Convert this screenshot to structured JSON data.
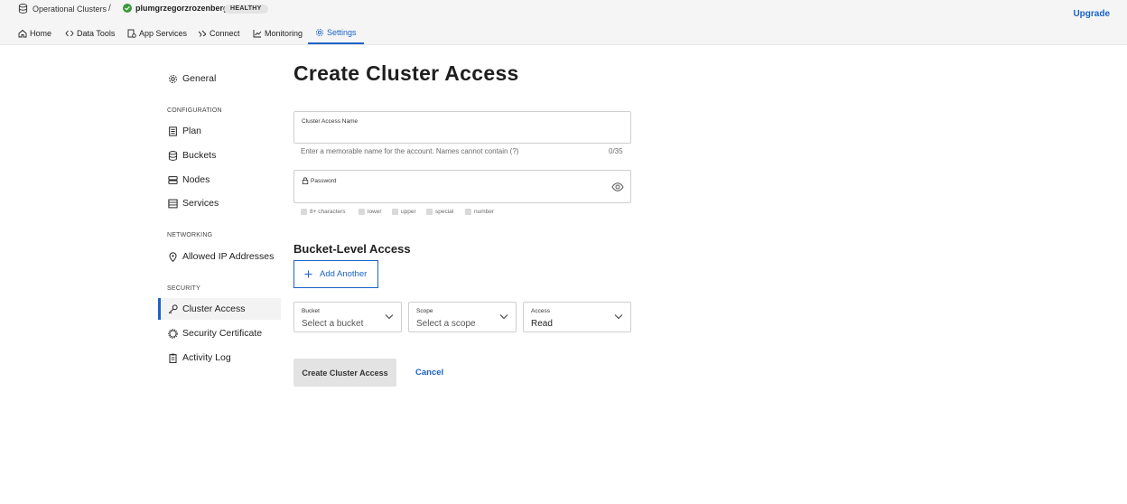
{
  "breadcrumb": {
    "root": "Operational Clusters",
    "separator": "/",
    "cluster": "plumgrzegorzrozenberg",
    "status": "HEALTHY"
  },
  "header": {
    "upgrade": "Upgrade"
  },
  "tabs": [
    {
      "label": "Home",
      "icon": "home-icon"
    },
    {
      "label": "Data Tools",
      "icon": "code-icon"
    },
    {
      "label": "App Services",
      "icon": "app-services-icon"
    },
    {
      "label": "Connect",
      "icon": "connect-icon"
    },
    {
      "label": "Monitoring",
      "icon": "chart-icon"
    },
    {
      "label": "Settings",
      "icon": "gear-icon",
      "active": true
    }
  ],
  "sidebar": {
    "general": "General",
    "configuration_heading": "CONFIGURATION",
    "configuration": [
      "Plan",
      "Buckets",
      "Nodes",
      "Services"
    ],
    "networking_heading": "NETWORKING",
    "networking": [
      "Allowed IP Addresses"
    ],
    "security_heading": "SECURITY",
    "security": [
      "Cluster Access",
      "Security Certificate",
      "Activity Log"
    ],
    "active": "Cluster Access"
  },
  "main": {
    "title": "Create Cluster Access",
    "name_field": {
      "label": "Cluster Access Name",
      "helper": "Enter a memorable name for the account. Names cannot contain (?)",
      "counter": "0/35",
      "value": ""
    },
    "password_field": {
      "label": "Password",
      "value": ""
    },
    "requirements": [
      "8+ characters",
      "lower",
      "upper",
      "special",
      "number"
    ],
    "bucket_section_title": "Bucket-Level Access",
    "add_another": "Add Another",
    "bucket_select": {
      "label": "Bucket",
      "value": "Select a bucket"
    },
    "scope_select": {
      "label": "Scope",
      "value": "Select a scope"
    },
    "access_select": {
      "label": "Access",
      "value": "Read"
    },
    "create_button": "Create Cluster Access",
    "cancel_button": "Cancel"
  },
  "colors": {
    "accent": "#1a63c7",
    "healthy": "#3a9a3a"
  }
}
